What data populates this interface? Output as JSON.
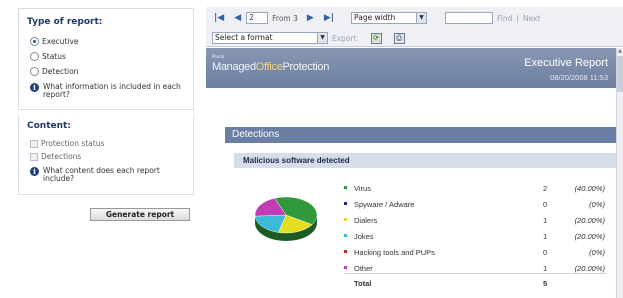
{
  "left_panel": {
    "report_type_heading": "Type of report:",
    "report_types": [
      {
        "label": "Executive",
        "selected": true
      },
      {
        "label": "Status",
        "selected": false
      },
      {
        "label": "Detection",
        "selected": false
      }
    ],
    "report_type_help": "What information is included in each report?",
    "content_heading": "Content:",
    "content_items": [
      {
        "label": "Protection status",
        "checked": true
      },
      {
        "label": "Detections",
        "checked": true
      }
    ],
    "content_help": "What content does each report include?",
    "generate_label": "Generate report"
  },
  "toolbar": {
    "page_value": "2",
    "page_of": "From 3",
    "zoom_value": "Page width",
    "find_label": "Find",
    "separator": "|",
    "next_label": "Next",
    "format_value": "Select a format",
    "export_label": "Export",
    "nav_first": "|◀",
    "nav_prev": "◀",
    "nav_next": "▶",
    "nav_last": "▶|"
  },
  "report": {
    "logo_small": "Panda",
    "logo_pre": "Managed",
    "logo_office": "Office",
    "logo_post": "Protection",
    "title": "Executive Report",
    "date": "08/20/2008 11:53",
    "section_title": "Detections",
    "subsection_title": "Malicious software detected",
    "total_label": "Total",
    "total_count": "5"
  },
  "chart_data": {
    "type": "pie",
    "title": "",
    "slices": [
      {
        "label": "Virus",
        "count": 2,
        "percent": "(40.00%)",
        "color": "#2e9a3c"
      },
      {
        "label": "Spyware / Adware",
        "count": 0,
        "percent": "(0%)",
        "color": "#1a2a8a"
      },
      {
        "label": "Dialers",
        "count": 1,
        "percent": "(20.00%)",
        "color": "#e6dc20"
      },
      {
        "label": "Jokes",
        "count": 1,
        "percent": "(20.00%)",
        "color": "#3bbbd6"
      },
      {
        "label": "Hacking tools and PUPs",
        "count": 0,
        "percent": "(0%)",
        "color": "#d12222"
      },
      {
        "label": "Other",
        "count": 1,
        "percent": "(20.00%)",
        "color": "#c43bb6"
      }
    ],
    "legend": "right"
  }
}
